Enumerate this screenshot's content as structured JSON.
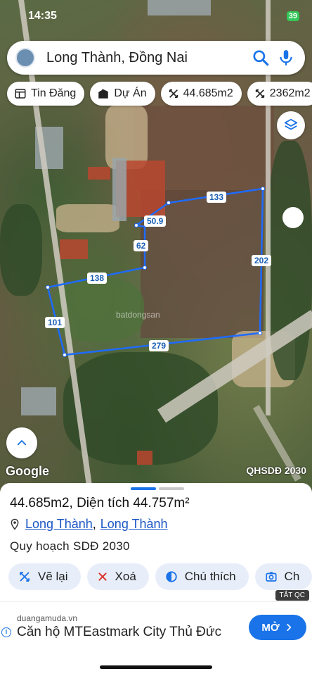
{
  "status": {
    "time": "14:35",
    "battery": "39"
  },
  "search": {
    "query": "Long Thành, Đồng Nai"
  },
  "chips": [
    {
      "label": "Tin Đăng",
      "icon": "news-icon"
    },
    {
      "label": "Dự Án",
      "icon": "building-icon"
    },
    {
      "label": "44.685m2",
      "icon": "area-icon"
    },
    {
      "label": "2362m2",
      "icon": "area-icon"
    }
  ],
  "map": {
    "dimensions": [
      "133",
      "50.9",
      "62",
      "202",
      "138",
      "101",
      "279"
    ],
    "attribution": "Google",
    "layer_label": "QHSDĐ 2030",
    "watermark": "batdongsan"
  },
  "sheet": {
    "title": "44.685m2, Diện tích 44.757m²",
    "location_1": "Long Thành",
    "separator": ",",
    "location_2": "Long Thành",
    "plan": "Quy hoạch SDĐ 2030",
    "actions": [
      {
        "label": "Vẽ lại",
        "icon": "redraw-icon"
      },
      {
        "label": "Xoá",
        "icon": "close-icon"
      },
      {
        "label": "Chú thích",
        "icon": "legend-icon"
      },
      {
        "label": "Ch",
        "icon": "camera-icon"
      }
    ]
  },
  "ad": {
    "badge": "TẮT QC",
    "domain": "duangamuda.vn",
    "title": "Căn hộ MTEastmark City Thủ Đức",
    "button": "MỞ"
  },
  "colors": {
    "accent": "#1a73e8",
    "plot_line": "#1e6bff"
  }
}
